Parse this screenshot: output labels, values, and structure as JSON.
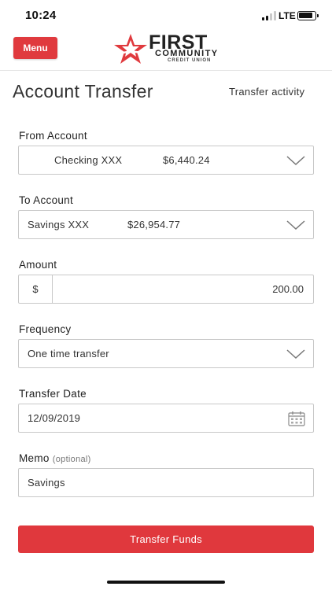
{
  "status_bar": {
    "time": "10:24",
    "network": "LTE"
  },
  "header": {
    "menu_label": "Menu",
    "logo": {
      "line1": "FIRST",
      "line2": "COMMUNITY",
      "line3": "CREDIT UNION"
    }
  },
  "page": {
    "title": "Account Transfer",
    "activity_link": "Transfer activity"
  },
  "form": {
    "from_account": {
      "label": "From Account",
      "account_name": "Checking XXX",
      "balance": "$6,440.24"
    },
    "to_account": {
      "label": "To Account",
      "account_name": "Savings XXX",
      "balance": "$26,954.77"
    },
    "amount": {
      "label": "Amount",
      "currency_symbol": "$",
      "value": "200.00"
    },
    "frequency": {
      "label": "Frequency",
      "value": "One time transfer"
    },
    "transfer_date": {
      "label": "Transfer Date",
      "value": "12/09/2019"
    },
    "memo": {
      "label": "Memo",
      "optional_note": "(optional)",
      "value": "Savings"
    },
    "submit_label": "Transfer Funds"
  },
  "colors": {
    "brand_red": "#e03a3e",
    "border": "#c8c8c8",
    "text": "#333333"
  },
  "icons": [
    "signal-icon",
    "battery-icon",
    "star-logo-icon",
    "chevron-down-icon",
    "calendar-icon"
  ]
}
